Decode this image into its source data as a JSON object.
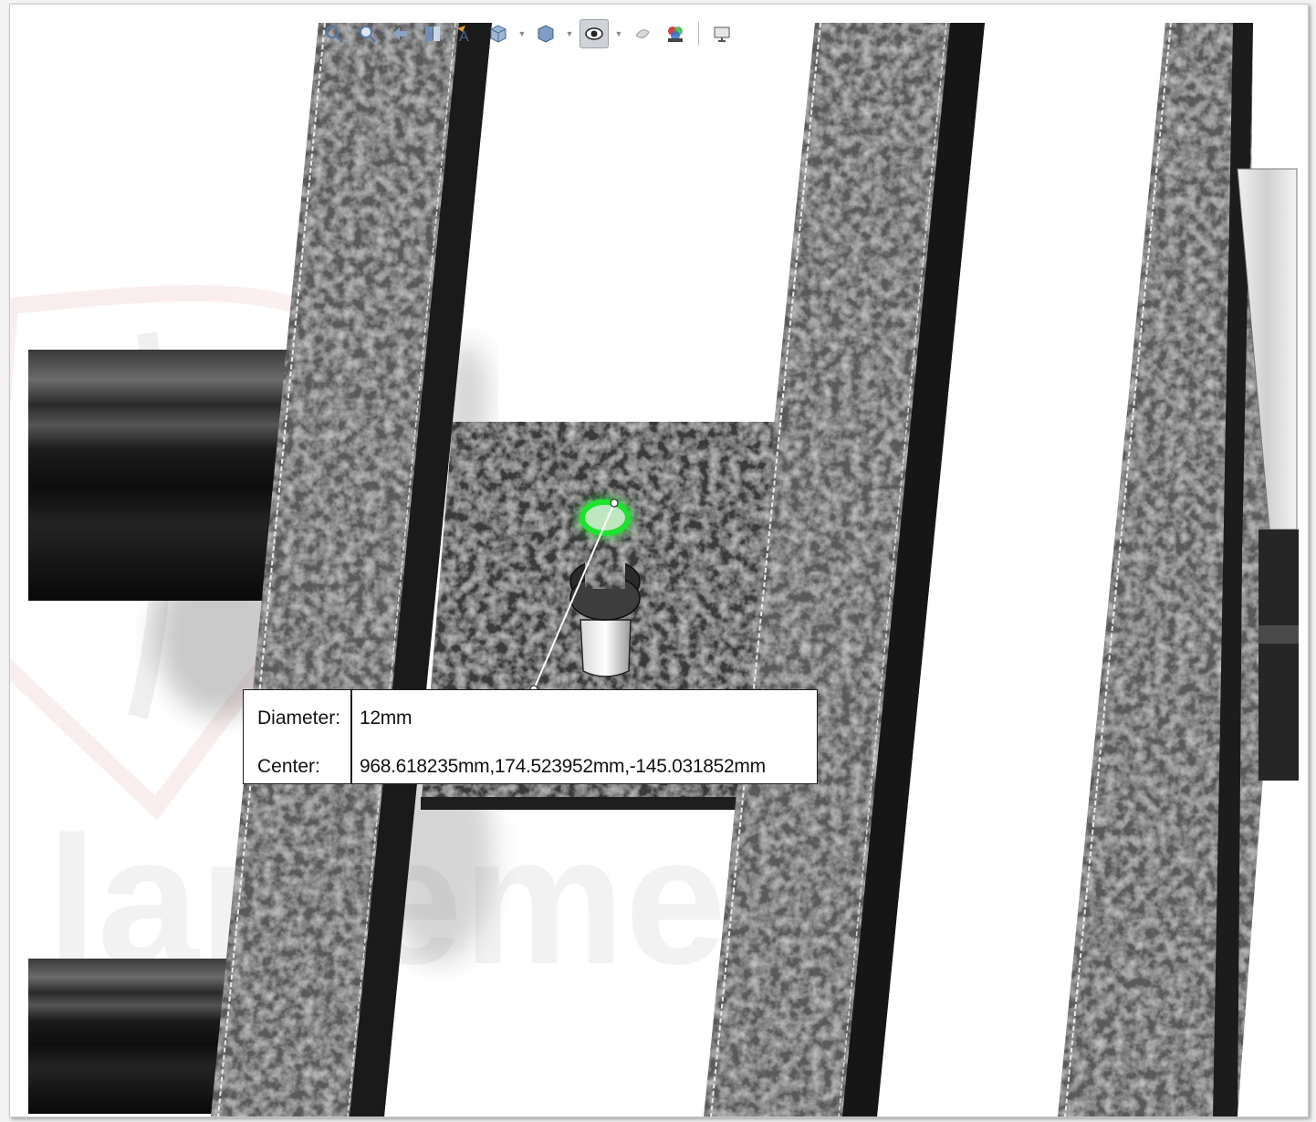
{
  "toolbar": {
    "buttons": [
      {
        "name": "zoom-to-fit-icon"
      },
      {
        "name": "zoom-to-area-icon"
      },
      {
        "name": "previous-view-icon"
      },
      {
        "name": "section-view-icon"
      },
      {
        "name": "dynamic-annotation-views-icon"
      },
      {
        "name": "view-orientation-icon"
      },
      {
        "name": "display-style-icon"
      },
      {
        "name": "hide-show-items-icon"
      },
      {
        "name": "edit-appearance-icon"
      },
      {
        "name": "apply-scene-icon"
      },
      {
        "name": "view-settings-icon"
      }
    ]
  },
  "measure_tooltip": {
    "diameter_label": "Diameter:",
    "diameter_value": "12mm",
    "center_label": "Center:",
    "center_value": "968.618235mm,174.523952mm,-145.031852mm"
  },
  "colors": {
    "selection_highlight": "#22dd33",
    "beam_texture": "#5e5e5e",
    "background": "#ffffff"
  }
}
